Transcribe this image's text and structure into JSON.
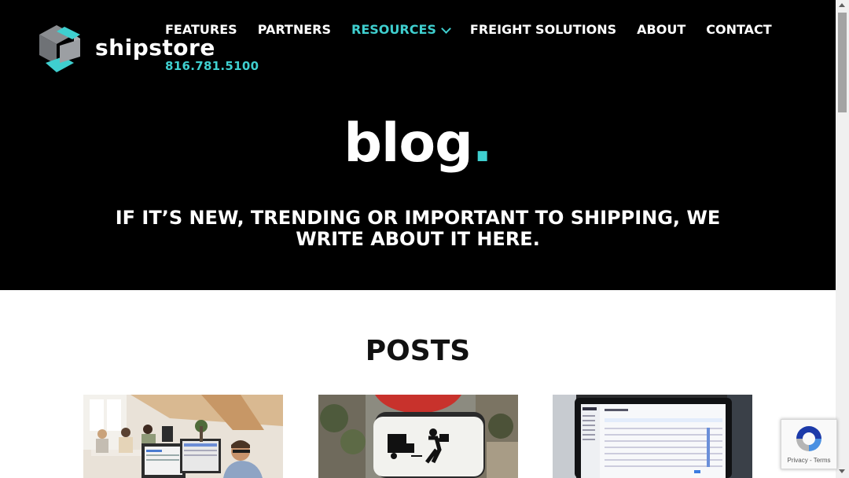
{
  "brand": {
    "name": "shipstore",
    "phone": "816.781.5100"
  },
  "nav": {
    "items": [
      {
        "label": "FEATURES"
      },
      {
        "label": "PARTNERS"
      },
      {
        "label": "RESOURCES",
        "active": true,
        "has_dropdown": true
      },
      {
        "label": "FREIGHT SOLUTIONS"
      },
      {
        "label": "ABOUT"
      },
      {
        "label": "CONTACT"
      }
    ]
  },
  "hero": {
    "title": "blog",
    "title_dot": ".",
    "tagline": "IF IT’S NEW, TRENDING OR IMPORTANT TO SHIPPING, WE WRITE ABOUT IT HERE."
  },
  "posts": {
    "heading": "POSTS",
    "items": [
      {
        "image_icon": "office-team-photo"
      },
      {
        "image_icon": "delivery-sign-photo"
      },
      {
        "image_icon": "laptop-dashboard-photo"
      }
    ]
  },
  "recaptcha": {
    "privacy": "Privacy",
    "sep": " - ",
    "terms": "Terms"
  },
  "colors": {
    "accent": "#3fcfcf",
    "hero_bg": "#000000",
    "text_dark": "#111111",
    "logo_gray": "#8a8d91"
  }
}
